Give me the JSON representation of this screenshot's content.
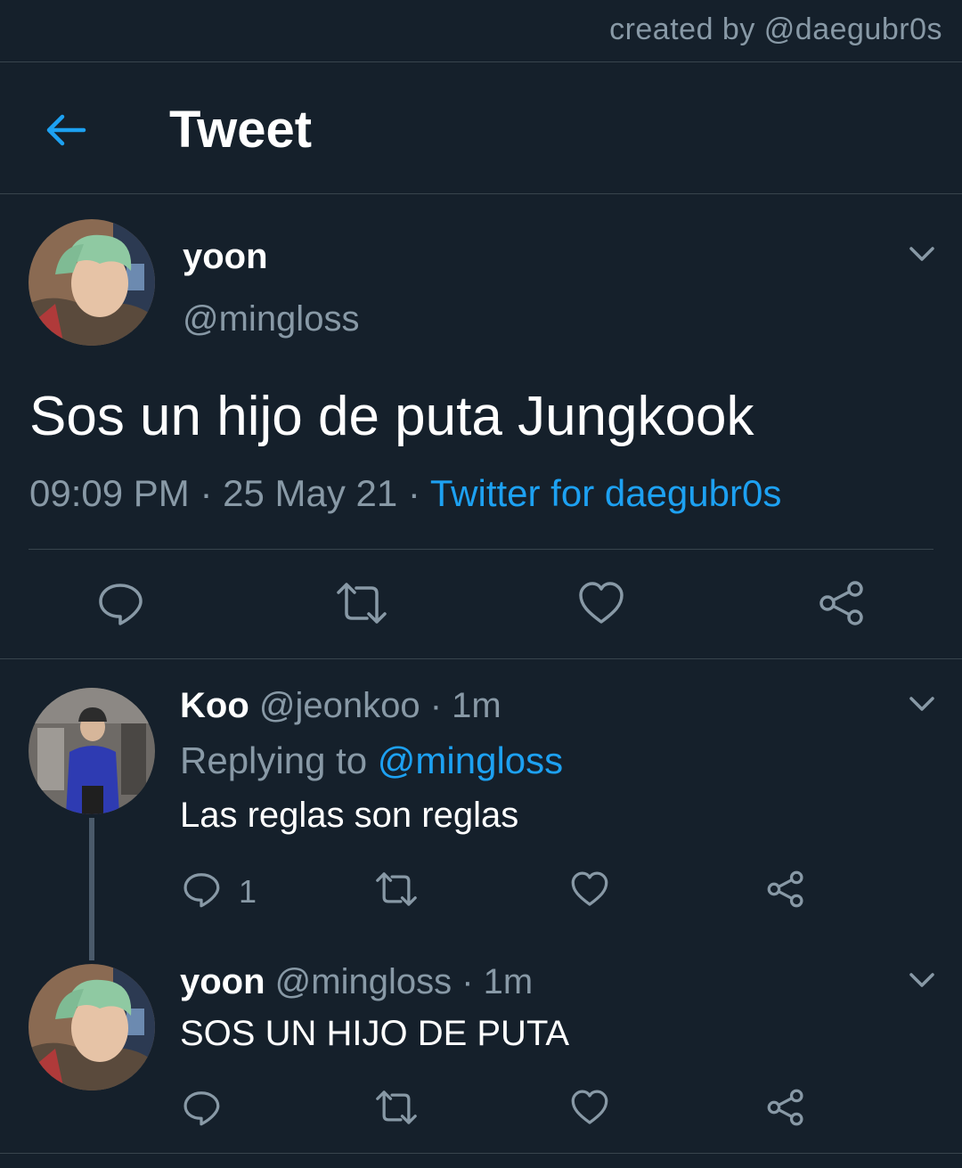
{
  "credit": "created by @daegubr0s",
  "header": {
    "title": "Tweet",
    "back_icon": "arrow-left-icon"
  },
  "main_tweet": {
    "display_name": "yoon",
    "handle": "@mingloss",
    "text": "Sos un hijo de puta Jungkook",
    "time": "09:09 PM",
    "date": "25 May 21",
    "source": "Twitter for daegubr0s",
    "sep1": " · ",
    "sep2": " · "
  },
  "replies": [
    {
      "display_name": "Koo",
      "handle": "@jeonkoo",
      "time": "1m",
      "dot": " · ",
      "replying_prefix": "Replying to ",
      "replying_to": "@mingloss",
      "text": "Las reglas son reglas",
      "reply_count": "1"
    },
    {
      "display_name": "yoon",
      "handle": "@mingloss",
      "time": "1m",
      "dot": " · ",
      "text": "SOS UN HIJO DE PUTA"
    }
  ],
  "colors": {
    "background": "#15202b",
    "accent": "#1da1f2",
    "secondary_text": "#8899a6",
    "divider": "#38444d"
  },
  "icons": [
    "arrow-left-icon",
    "chevron-down-icon",
    "reply-icon",
    "retweet-icon",
    "like-icon",
    "share-icon"
  ]
}
